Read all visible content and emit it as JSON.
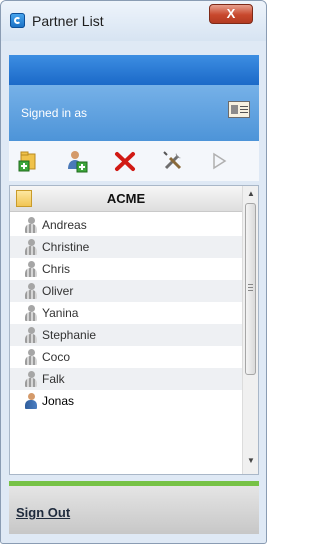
{
  "window": {
    "title": "Partner List",
    "close_label": "X"
  },
  "signed_in": {
    "label": "Signed in as",
    "card_icon": "id-card-icon"
  },
  "toolbar": {
    "icons": [
      "add-group-icon",
      "add-partner-icon",
      "delete-icon",
      "settings-icon",
      "play-icon"
    ]
  },
  "group": {
    "name": "ACME",
    "icon": "folder-icon"
  },
  "partners": [
    {
      "name": "Andreas",
      "active": false
    },
    {
      "name": "Christine",
      "active": false
    },
    {
      "name": "Chris",
      "active": false
    },
    {
      "name": "Oliver",
      "active": false
    },
    {
      "name": "Yanina",
      "active": false
    },
    {
      "name": "Stephanie",
      "active": false
    },
    {
      "name": "Coco",
      "active": false
    },
    {
      "name": "Falk",
      "active": false
    },
    {
      "name": "Jonas",
      "active": true
    }
  ],
  "footer": {
    "sign_out_label": "Sign Out"
  },
  "colors": {
    "banner": "#1b69c8",
    "signed_in_bg": "#5a9fe0",
    "status_bar": "#77c246",
    "delete": "#d11a14"
  }
}
